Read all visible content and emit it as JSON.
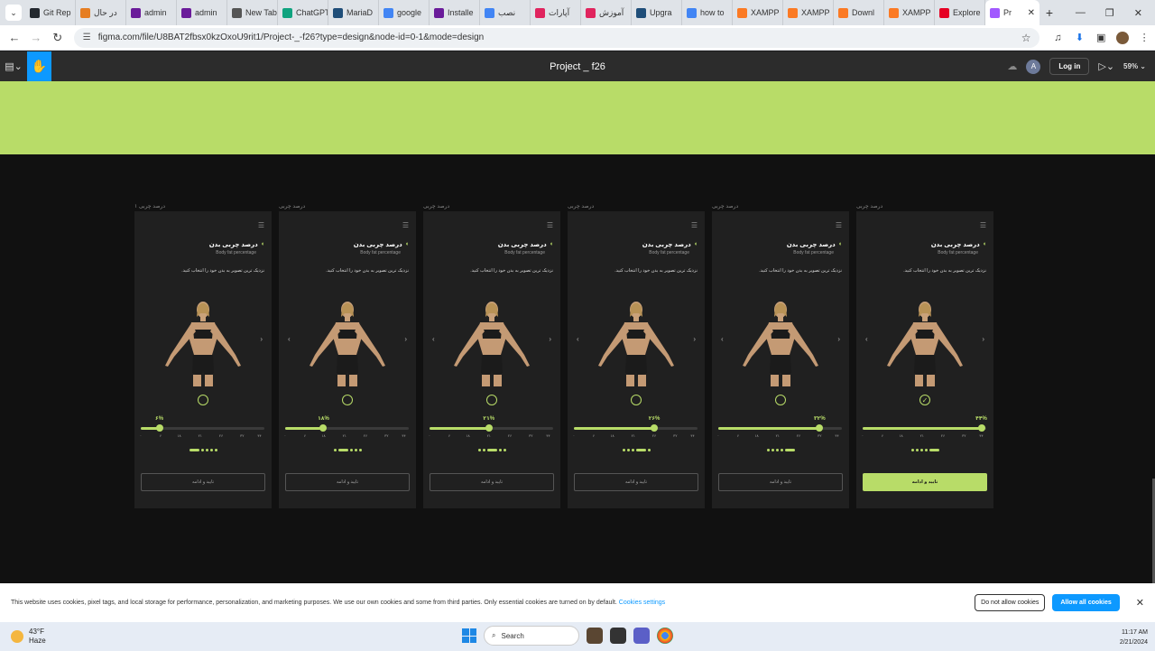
{
  "browser": {
    "tabs": [
      {
        "label": "Git Rep",
        "color": "#24292f"
      },
      {
        "label": "در حال",
        "color": "#e67e22"
      },
      {
        "label": "admin",
        "color": "#6a1b9a"
      },
      {
        "label": "admin",
        "color": "#6a1b9a"
      },
      {
        "label": "New Tab",
        "color": "#555555"
      },
      {
        "label": "ChatGPT",
        "color": "#10a37f"
      },
      {
        "label": "MariaD",
        "color": "#1f4e79"
      },
      {
        "label": "google",
        "color": "#4285f4"
      },
      {
        "label": "Installe",
        "color": "#6a1b9a"
      },
      {
        "label": "نصب",
        "color": "#4285f4"
      },
      {
        "label": "آپارات",
        "color": "#e0245e"
      },
      {
        "label": "آموزش",
        "color": "#e0245e"
      },
      {
        "label": "Upgra",
        "color": "#1f4e79"
      },
      {
        "label": "how to",
        "color": "#4285f4"
      },
      {
        "label": "XAMPP",
        "color": "#fb7a24"
      },
      {
        "label": "XAMPP",
        "color": "#fb7a24"
      },
      {
        "label": "Downl",
        "color": "#fb7a24"
      },
      {
        "label": "XAMPP",
        "color": "#fb7a24"
      },
      {
        "label": "Explore",
        "color": "#e60023"
      }
    ],
    "active_tab": {
      "label": "Pr",
      "color": "#a259ff"
    },
    "url": "figma.com/file/U8BAT2fbsx0kzOxoU9rit1/Project-_-f26?type=design&node-id=0-1&mode=design"
  },
  "figma": {
    "file_title": "Project _ f26",
    "user_initial": "A",
    "login_label": "Log in",
    "zoom": "59%"
  },
  "frames": [
    {
      "label": "درصد چربی ۱",
      "value": 0.15,
      "pct": "۶%",
      "active_dot": 0,
      "selected": false
    },
    {
      "label": "درصد چربی",
      "value": 0.31,
      "pct": "۱۸%",
      "active_dot": 1,
      "selected": false
    },
    {
      "label": "درصد چربی",
      "value": 0.48,
      "pct": "۲۱%",
      "active_dot": 2,
      "selected": false
    },
    {
      "label": "درصد چربی",
      "value": 0.65,
      "pct": "۲۶%",
      "active_dot": 3,
      "selected": false
    },
    {
      "label": "درصد چربی",
      "value": 0.82,
      "pct": "۳۲%",
      "active_dot": 4,
      "selected": false
    },
    {
      "label": "درصد چربی",
      "value": 0.96,
      "pct": "۴۴%",
      "active_dot": 5,
      "selected": true
    }
  ],
  "screen": {
    "title": "درصد چربی بدن",
    "subtitle": "Body fat percentage",
    "description": "نزدیک ترین تصویر به بدن خود را انتخاب کنید.",
    "button_label": "تایید و ادامه",
    "tick_labels": [
      "۰",
      "۶",
      "۱۸",
      "۲۱",
      "۲۶",
      "۳۲",
      "۴۴"
    ]
  },
  "cookie": {
    "message": "This website uses cookies, pixel tags, and local storage for performance, personalization, and marketing purposes. We use our own cookies and some from third parties. Only essential cookies are turned on by default.",
    "settings_link": "Cookies settings",
    "deny_label": "Do not allow cookies",
    "allow_label": "Allow all cookies"
  },
  "taskbar": {
    "temp": "43°F",
    "condition": "Haze",
    "search_placeholder": "Search",
    "time": "11:17 AM",
    "date": "2/21/2024"
  },
  "colors": {
    "accent": "#b8dc68",
    "figma_blue": "#0d99ff"
  }
}
